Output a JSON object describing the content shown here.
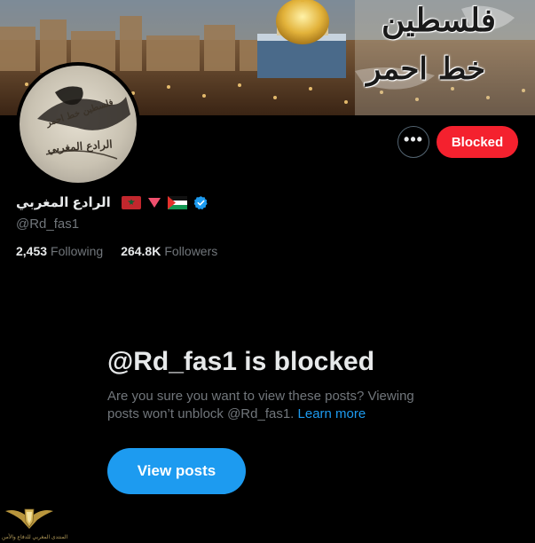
{
  "banner": {
    "line1": "فلسطين",
    "line2": "خط احمر"
  },
  "avatar": {
    "line1": "فلسطين خط احمر",
    "line2": "الرادع المغربي"
  },
  "actions": {
    "more_label": "•••",
    "blocked_label": "Blocked"
  },
  "profile": {
    "display_name": "الرادع المغربي",
    "flags": [
      "morocco-flag",
      "red-triangle-icon",
      "palestine-flag"
    ],
    "verified": true,
    "handle": "@Rd_fas1"
  },
  "stats": {
    "following_count": "2,453",
    "following_label": "Following",
    "followers_count": "264.8K",
    "followers_label": "Followers"
  },
  "blocked_notice": {
    "title": "@Rd_fas1 is blocked",
    "description": "Are you sure you want to view these posts? Viewing posts won’t unblock @Rd_fas1.",
    "learn_more": "Learn more",
    "view_posts": "View posts"
  },
  "watermark": {
    "text": "المنتدى المغربي للدفاع والأمن"
  },
  "colors": {
    "background": "#000000",
    "blocked_red": "#f4212e",
    "accent_blue": "#1d9bf0",
    "muted_text": "#71767b",
    "primary_text": "#e7e9ea"
  }
}
